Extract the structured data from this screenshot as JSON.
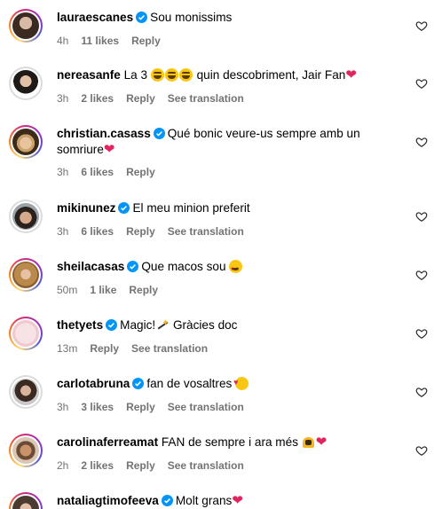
{
  "comments": [
    {
      "username": "lauraescanes",
      "verified": true,
      "text": "Sou monissims",
      "time": "4h",
      "likes": "11 likes",
      "reply": "Reply",
      "see_translation": ""
    },
    {
      "username": "nereasanfe",
      "verified": false,
      "text_pre": "La 3",
      "text_post": "quin descobriment, Jair Fan",
      "time": "3h",
      "likes": "2 likes",
      "reply": "Reply",
      "see_translation": "See translation"
    },
    {
      "username": "christian.casass",
      "verified": true,
      "text_line1": "Qué bonic veure-us sempre amb un",
      "text_line2": "somriure",
      "time": "3h",
      "likes": "6 likes",
      "reply": "Reply",
      "see_translation": ""
    },
    {
      "username": "mikinunez",
      "verified": true,
      "text": "El meu minion preferit",
      "time": "3h",
      "likes": "6 likes",
      "reply": "Reply",
      "see_translation": "See translation"
    },
    {
      "username": "sheilacasas",
      "verified": true,
      "text": "Que macos sou",
      "time": "50m",
      "likes": "1 like",
      "reply": "Reply",
      "see_translation": ""
    },
    {
      "username": "thetyets",
      "verified": true,
      "text_pre": "Magic!",
      "text_post": "Gràcies doc",
      "time": "13m",
      "likes": "",
      "reply": "Reply",
      "see_translation": "See translation"
    },
    {
      "username": "carlotabruna",
      "verified": true,
      "text": "fan de vosaltres",
      "time": "3h",
      "likes": "3 likes",
      "reply": "Reply",
      "see_translation": "See translation"
    },
    {
      "username": "carolinaferreamat",
      "verified": false,
      "text": "FAN de sempre i ara més",
      "time": "2h",
      "likes": "2 likes",
      "reply": "Reply",
      "see_translation": "See translation"
    },
    {
      "username": "nataliagtimofeeva",
      "verified": true,
      "text": "Molt grans"
    }
  ],
  "icons": {
    "verified": "verified-badge-icon",
    "like": "heart-outline-icon"
  },
  "colors": {
    "verified": "#0095f6",
    "meta": "#737373",
    "red_heart": "#e0245e"
  }
}
